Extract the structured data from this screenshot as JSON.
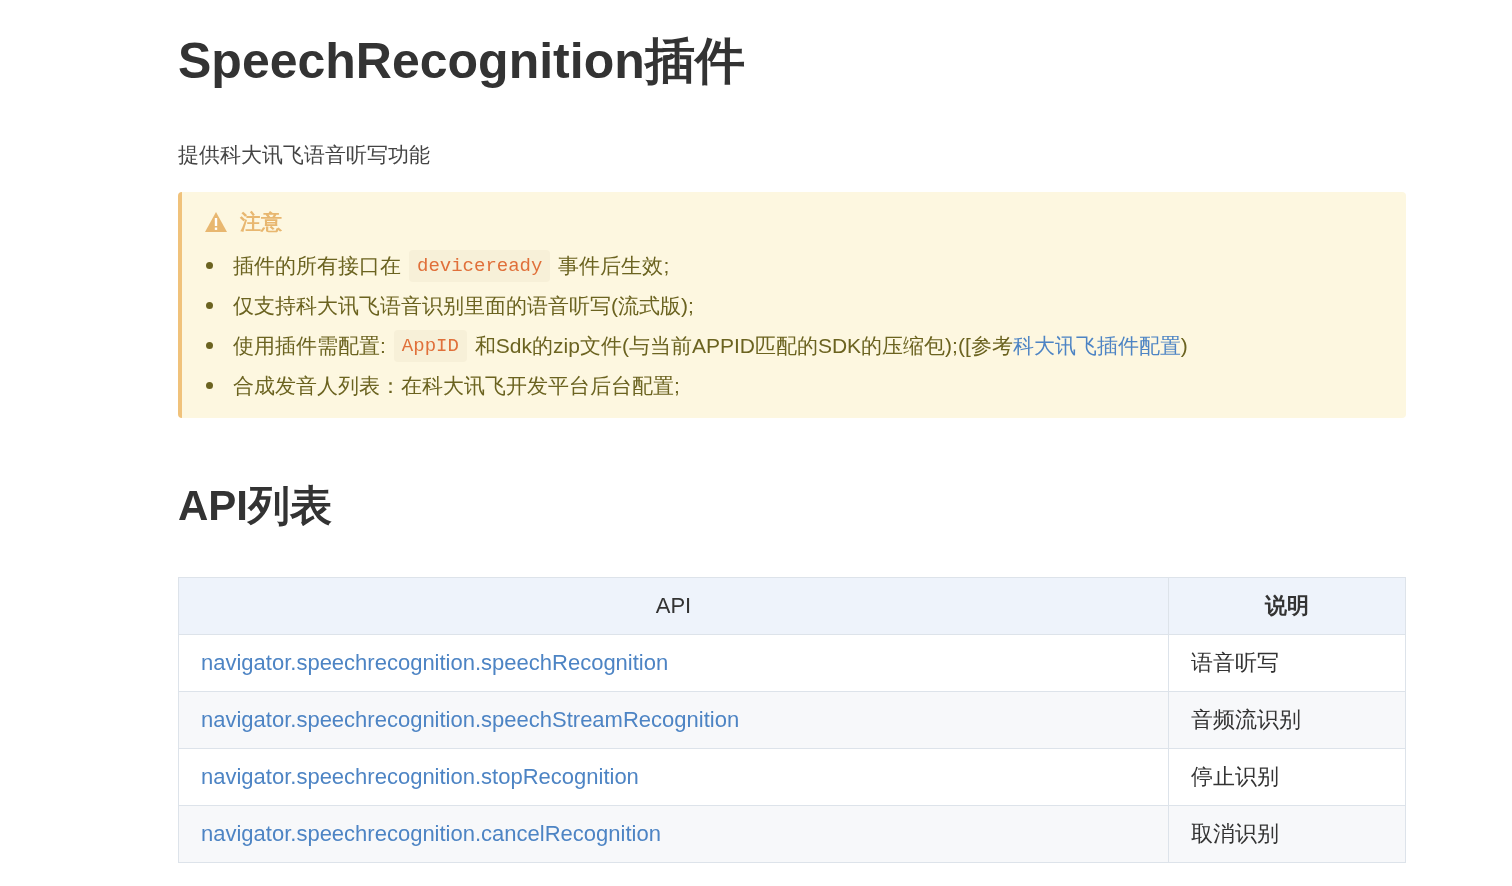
{
  "title": "SpeechRecognition插件",
  "description": "提供科大讯飞语音听写功能",
  "notice": {
    "title": "注意",
    "items": [
      {
        "segments": [
          {
            "kind": "text",
            "text": "插件的所有接口在"
          },
          {
            "kind": "code",
            "text": "deviceready"
          },
          {
            "kind": "text",
            "text": "事件后生效;"
          }
        ]
      },
      {
        "segments": [
          {
            "kind": "text",
            "text": "仅支持科大讯飞语音识别里面的语音听写(流式版);"
          }
        ]
      },
      {
        "segments": [
          {
            "kind": "text",
            "text": "使用插件需配置:"
          },
          {
            "kind": "code",
            "text": "AppID"
          },
          {
            "kind": "text",
            "text": "和Sdk的zip文件(与当前APPID匹配的SDK的压缩包);([参考"
          },
          {
            "kind": "link",
            "text": "科大讯飞插件配置"
          },
          {
            "kind": "text",
            "text": ")"
          }
        ]
      },
      {
        "segments": [
          {
            "kind": "text",
            "text": "合成发音人列表：在科大讯飞开发平台后台配置;"
          }
        ]
      }
    ]
  },
  "api_heading": "API列表",
  "table": {
    "columns": [
      "API",
      "说明"
    ],
    "rows": [
      {
        "api": "navigator.speechrecognition.speechRecognition",
        "desc": "语音听写"
      },
      {
        "api": "navigator.speechrecognition.speechStreamRecognition",
        "desc": "音频流识别"
      },
      {
        "api": "navigator.speechrecognition.stopRecognition",
        "desc": "停止识别"
      },
      {
        "api": "navigator.speechrecognition.cancelRecognition",
        "desc": "取消识别"
      }
    ]
  }
}
